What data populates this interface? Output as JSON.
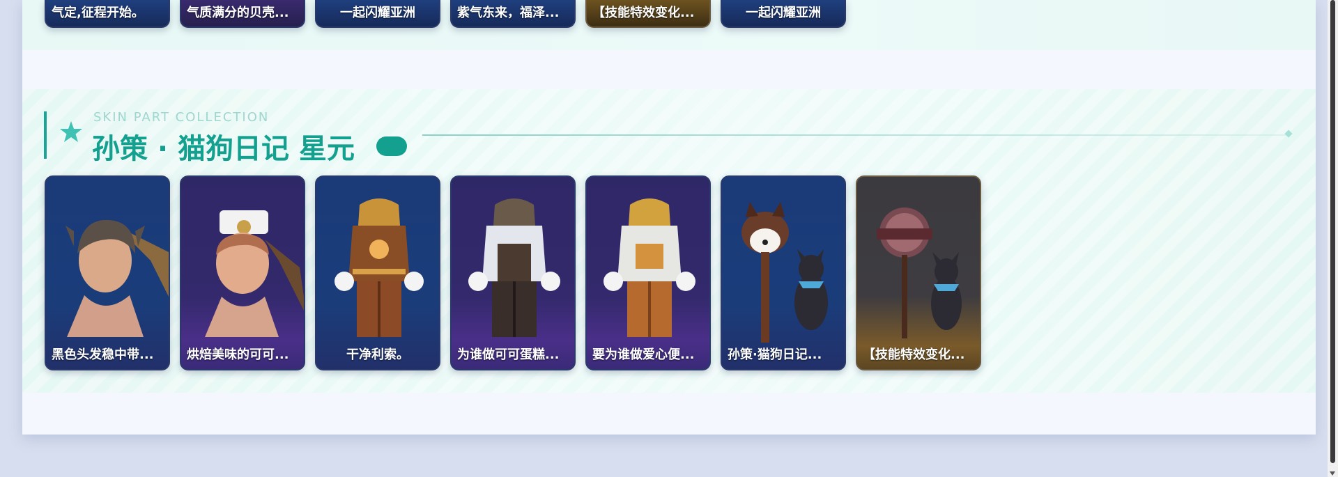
{
  "top_row": {
    "cards": [
      {
        "name": "气定,征程开始。",
        "theme": "blue"
      },
      {
        "name": "气质满分的贝壳...",
        "theme": "purple"
      },
      {
        "name": "一起闪耀亚洲",
        "theme": "blue"
      },
      {
        "name": "紫气东来，福泽...",
        "theme": "blue"
      },
      {
        "name": "【技能特效变化...",
        "theme": "gold"
      },
      {
        "name": "一起闪耀亚洲",
        "theme": "blue"
      }
    ]
  },
  "section": {
    "subtitle": "SKIN PART COLLECTION",
    "title": "孙策 · 猫狗日记 星元",
    "accent_color": "#14a08f",
    "icon": "star-icon",
    "cards": [
      {
        "name": "黑色头发稳中带...",
        "theme": "blue",
        "icon": "head-hair-icon"
      },
      {
        "name": "烘焙美味的可可...",
        "theme": "purple",
        "icon": "head-chef-icon"
      },
      {
        "name": "干净利索。",
        "theme": "blue",
        "icon": "hoodie-outfit-icon"
      },
      {
        "name": "为谁做可可蛋糕...",
        "theme": "purple",
        "icon": "apron-outfit-icon"
      },
      {
        "name": "要为谁做爱心便...",
        "theme": "purple",
        "icon": "jacket-outfit-icon"
      },
      {
        "name": "孙策·猫狗日记...",
        "theme": "blue",
        "icon": "dog-staff-icon"
      },
      {
        "name": "【技能特效变化...",
        "theme": "gold",
        "icon": "cake-shop-sign-icon"
      }
    ]
  }
}
